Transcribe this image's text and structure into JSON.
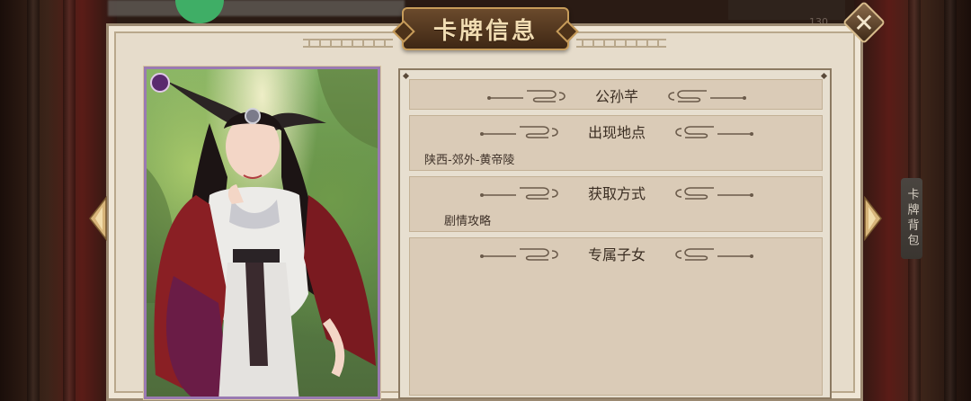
{
  "window": {
    "title": "卡牌信息"
  },
  "close": {
    "icon": "close-icon"
  },
  "side_tab": {
    "label": "卡牌背包"
  },
  "card": {
    "badge_icon": "rarity-badge-icon",
    "figure": "character-portrait"
  },
  "sections": [
    {
      "title": "公孙芊",
      "body": ""
    },
    {
      "title": "出现地点",
      "body": "陕西-郊外-黄帝陵"
    },
    {
      "title": "获取方式",
      "body": "剧情攻略"
    },
    {
      "title": "专属子女",
      "body": ""
    }
  ],
  "top_counter": "130"
}
